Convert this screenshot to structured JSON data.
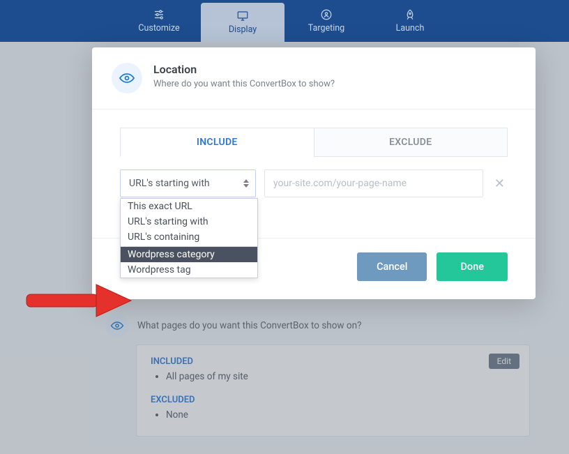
{
  "topbar": {
    "items": [
      {
        "label": "Customize"
      },
      {
        "label": "Display"
      },
      {
        "label": "Targeting"
      },
      {
        "label": "Launch"
      }
    ]
  },
  "modal": {
    "title": "Location",
    "subtitle": "Where do you want this ConvertBox to show?",
    "tabs": {
      "include": "INCLUDE",
      "exclude": "EXCLUDE"
    },
    "select_value": "URL's starting with",
    "url_placeholder": "your-site.com/your-page-name",
    "options": [
      "This exact URL",
      "URL's starting with",
      "URL's containing",
      "Wordpress category",
      "Wordpress tag"
    ],
    "cancel": "Cancel",
    "done": "Done"
  },
  "back": {
    "question": "What pages do you want this ConvertBox to show on?",
    "included_label": "INCLUDED",
    "included_items": [
      "All pages of my site"
    ],
    "excluded_label": "EXCLUDED",
    "excluded_items": [
      "None"
    ],
    "edit": "Edit"
  }
}
